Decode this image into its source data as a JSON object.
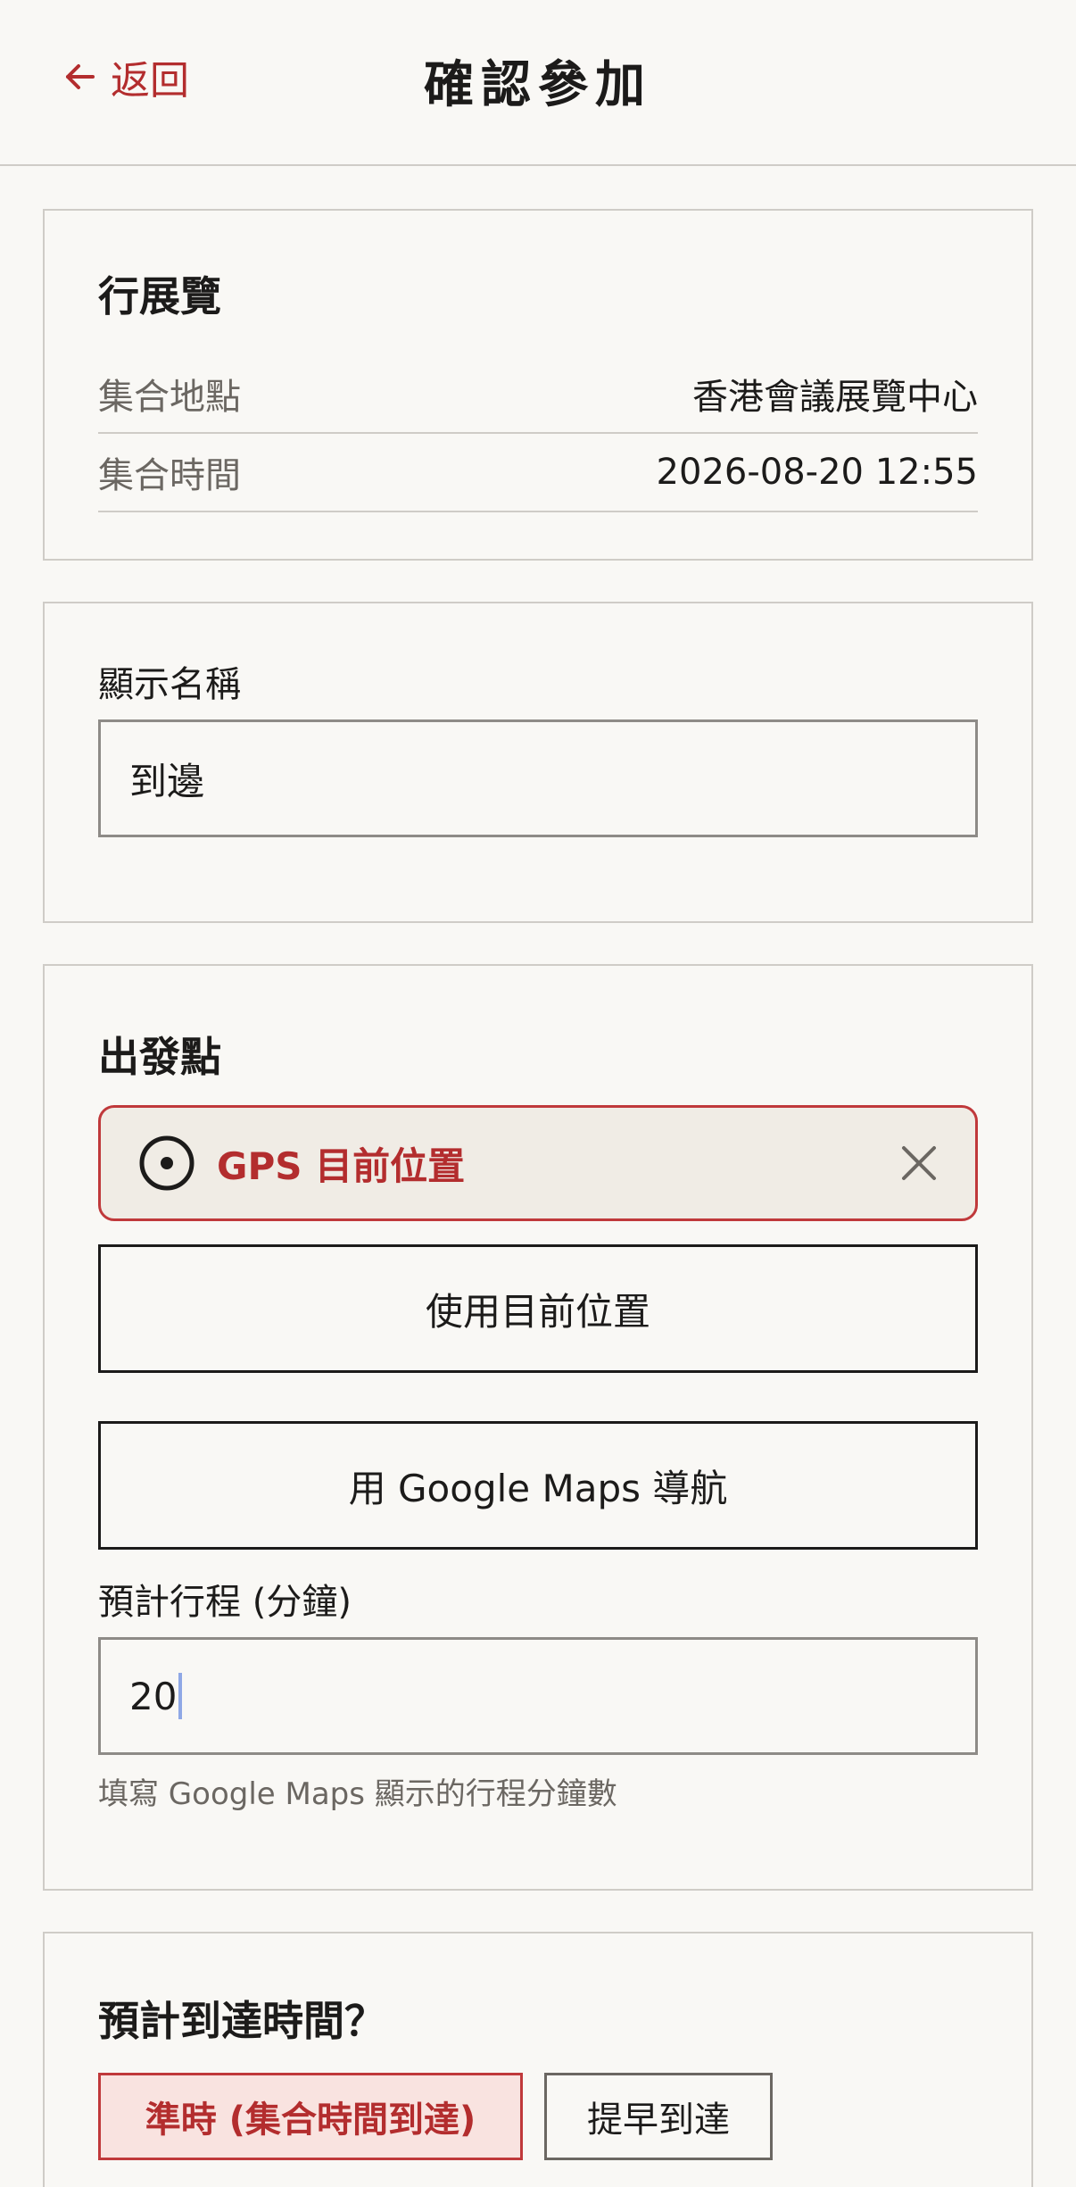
{
  "header": {
    "back_label": "返回",
    "title": "確認參加"
  },
  "event": {
    "title": "行展覽",
    "rows": [
      {
        "label": "集合地點",
        "value": "香港會議展覽中心"
      },
      {
        "label": "集合時間",
        "value": "2026-08-20 12:55"
      }
    ]
  },
  "display_name": {
    "label": "顯示名稱",
    "value": "到邊"
  },
  "departure": {
    "title": "出發點",
    "gps_text": "GPS 目前位置",
    "use_current_button": "使用目前位置",
    "google_maps_button": "用 Google Maps 導航",
    "duration_label": "預計行程 (分鐘)",
    "duration_value": "20",
    "duration_hint": "填寫 Google Maps 顯示的行程分鐘數"
  },
  "arrival": {
    "title": "預計到達時間？",
    "options": [
      {
        "label": "準時 (集合時間到達)",
        "selected": true
      },
      {
        "label": "提早到達",
        "selected": false
      }
    ]
  },
  "colors": {
    "accent": "#b32d2e",
    "background": "#f9f8f5",
    "border": "#cfccc7"
  },
  "icons": {
    "back": "arrow-left-icon",
    "gps": "target-icon",
    "close": "close-icon"
  }
}
